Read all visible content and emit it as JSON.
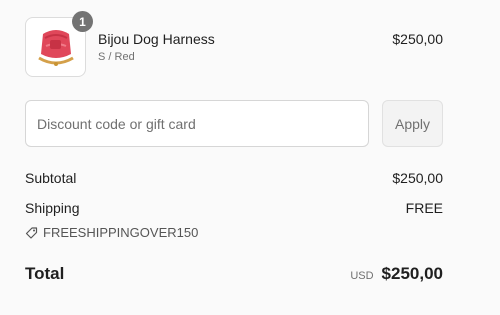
{
  "cart_item": {
    "quantity": "1",
    "name": "Bijou Dog Harness",
    "variant": "S / Red",
    "price": "$250,00",
    "image_icon": "dog-harness-image"
  },
  "discount": {
    "placeholder": "Discount code or gift card",
    "value": "",
    "apply_label": "Apply"
  },
  "totals": {
    "subtotal_label": "Subtotal",
    "subtotal_value": "$250,00",
    "shipping_label": "Shipping",
    "shipping_value": "FREE",
    "applied_code": "FREESHIPPINGOVER150",
    "code_icon": "tag-icon",
    "total_label": "Total",
    "currency": "USD",
    "total_value": "$250,00"
  },
  "colors": {
    "background": "#fafafa",
    "harness_red": "#e0475a",
    "badge": "#737373"
  }
}
